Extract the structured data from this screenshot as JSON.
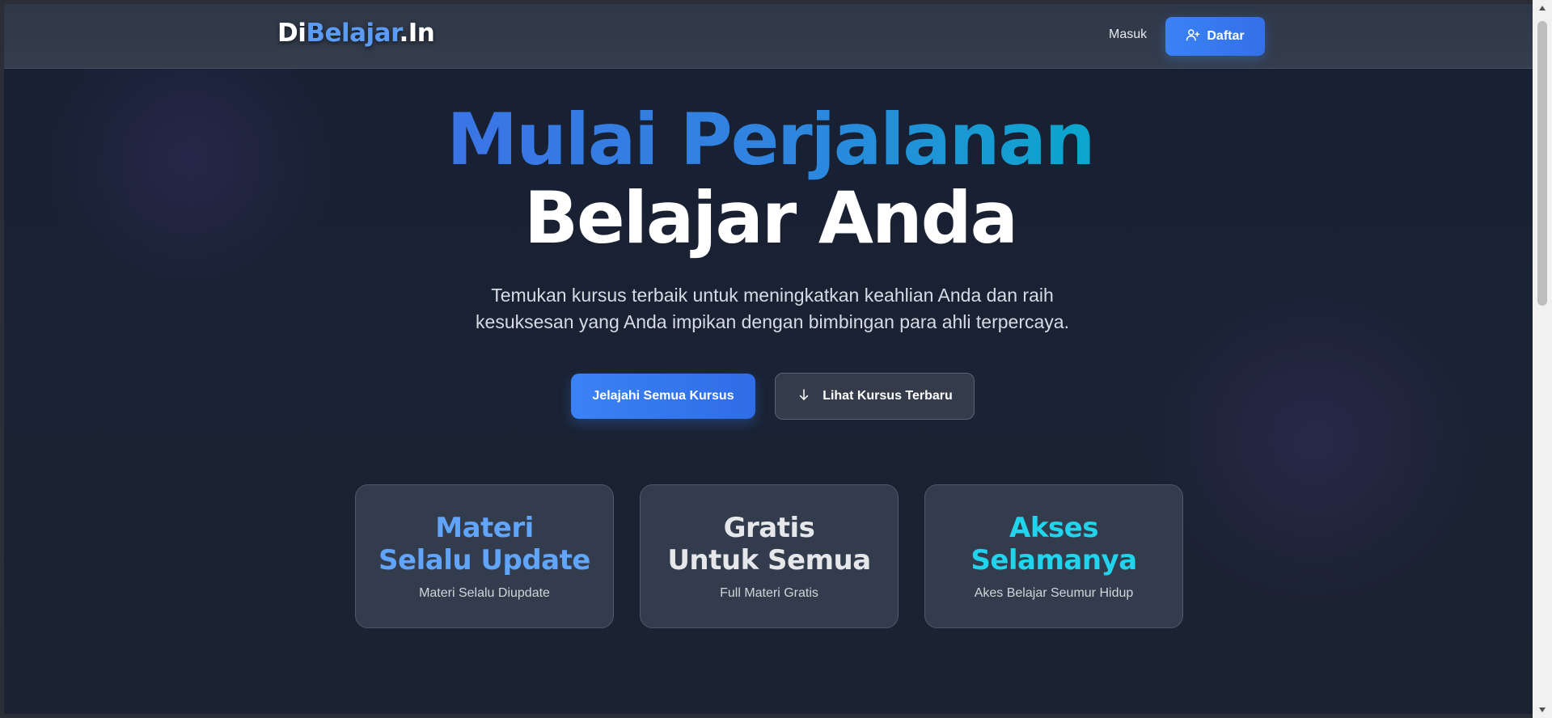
{
  "navbar": {
    "brand_part1": "Di",
    "brand_part2": "Belajar",
    "brand_part3": ".In",
    "login_label": "Masuk",
    "signup_label": "Daftar",
    "signup_icon": "user-plus-icon"
  },
  "hero": {
    "title_line1": "Mulai Perjalanan",
    "title_line2": "Belajar Anda",
    "subtitle_line1": "Temukan kursus terbaik untuk meningkatkan keahlian Anda dan raih",
    "subtitle_line2": "kesuksesan yang Anda impikan dengan bimbingan para ahli terpercaya.",
    "primary_button": "Jelajahi Semua Kursus",
    "secondary_button": "Lihat Kursus Terbaru",
    "secondary_icon": "arrow-down-icon"
  },
  "features": [
    {
      "title_line1": "Materi",
      "title_line2": "Selalu Update",
      "description": "Materi Selalu Diupdate",
      "color": "#60a5fa"
    },
    {
      "title_line1": "Gratis",
      "title_line2": "Untuk Semua",
      "description": "Full Materi Gratis",
      "color": "#e5e7eb"
    },
    {
      "title_line1": "Akses",
      "title_line2": "Selamanya",
      "description": "Akes Belajar Seumur Hidup",
      "color": "#22d3ee"
    }
  ],
  "colors": {
    "accent": "#3b82f6",
    "brand_blue": "#5b9bf5",
    "background": "#1a2233"
  }
}
